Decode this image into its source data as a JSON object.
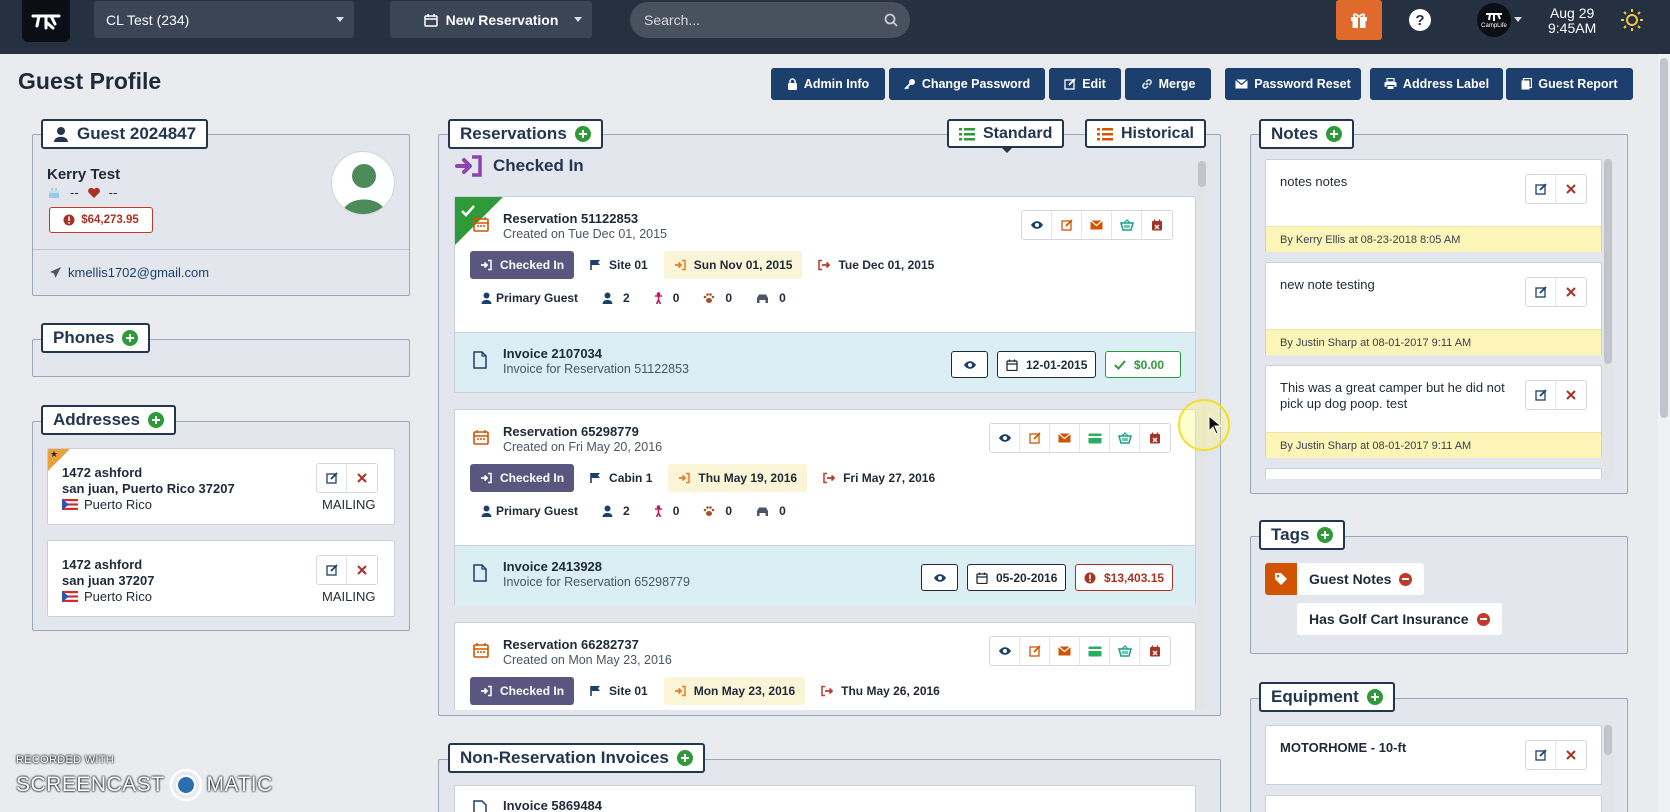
{
  "topbar": {
    "campground": "CL Test (234)",
    "new_reservation": "New Reservation",
    "search_placeholder": "Search...",
    "logo_text": "CampLife",
    "date": "Aug 29",
    "time": "9:45AM"
  },
  "header": {
    "title": "Guest Profile",
    "actions": [
      "Admin Info",
      "Change Password",
      "Edit",
      "Merge",
      "Password Reset",
      "Address Label",
      "Guest Report"
    ]
  },
  "guest": {
    "tab_title": "Guest 2024847",
    "name": "Kerry Test",
    "birthday": "--",
    "anniversary": "--",
    "balance": "$64,273.95",
    "email": "kmellis1702@gmail.com"
  },
  "phones": {
    "title": "Phones"
  },
  "addresses": {
    "title": "Addresses",
    "items": [
      {
        "line1": "1472 ashford",
        "line2": "san juan, Puerto Rico 37207",
        "country": "Puerto Rico",
        "type": "MAILING"
      },
      {
        "line1": "1472 ashford",
        "line2": "san juan 37207",
        "country": "Puerto Rico",
        "type": "MAILING"
      }
    ]
  },
  "reservations": {
    "title": "Reservations",
    "view_standard": "Standard",
    "view_historical": "Historical",
    "section": "Checked In",
    "items": [
      {
        "title": "Reservation 51122853",
        "created": "Created on Tue Dec 01, 2015",
        "status": "Checked In",
        "site": "Site 01",
        "arrive": "Sun Nov 01, 2015",
        "depart": "Tue Dec 01, 2015",
        "primary": "Primary Guest",
        "adults": "2",
        "children": "0",
        "pets": "0",
        "vehicles": "0",
        "invoice_title": "Invoice 2107034",
        "invoice_sub": "Invoice for Reservation 51122853",
        "invoice_date": "12-01-2015",
        "invoice_amount": "$0.00",
        "paid": true
      },
      {
        "title": "Reservation 65298779",
        "created": "Created on Fri May 20, 2016",
        "status": "Checked In",
        "site": "Cabin 1",
        "arrive": "Thu May 19, 2016",
        "depart": "Fri May 27, 2016",
        "primary": "Primary Guest",
        "adults": "2",
        "children": "0",
        "pets": "0",
        "vehicles": "0",
        "invoice_title": "Invoice 2413928",
        "invoice_sub": "Invoice for Reservation 65298779",
        "invoice_date": "05-20-2016",
        "invoice_amount": "$13,403.15",
        "paid": false
      },
      {
        "title": "Reservation 66282737",
        "created": "Created on Mon May 23, 2016",
        "status": "Checked In",
        "site": "Site 01",
        "arrive": "Mon May 23, 2016",
        "depart": "Thu May 26, 2016"
      }
    ]
  },
  "non_reservation": {
    "title": "Non-Reservation Invoices",
    "first_invoice": "Invoice 5869484"
  },
  "notes": {
    "title": "Notes",
    "items": [
      {
        "text": "notes notes",
        "by": "By Kerry Ellis at 08-23-2018 8:05 AM"
      },
      {
        "text": "new note testing",
        "by": "By Justin Sharp at 08-01-2017 9:11 AM"
      },
      {
        "text": "This was a great camper but he did not pick up dog poop. test",
        "by": "By Justin Sharp at 08-01-2017 9:11 AM"
      }
    ]
  },
  "tags": {
    "title": "Tags",
    "items": [
      "Guest Notes",
      "Has Golf Cart Insurance"
    ]
  },
  "equipment": {
    "title": "Equipment",
    "items": [
      "MOTORHOME - 10-ft"
    ]
  },
  "watermark": {
    "top": "RECORDED WITH",
    "brand_left": "SCREENCAST",
    "brand_right": "MATIC"
  },
  "colors": {
    "navy": "#1c3f6e",
    "green": "#2e9a3a",
    "danger": "#a93226",
    "checked_in": "#5b5680",
    "gift": "#e06a2c"
  }
}
